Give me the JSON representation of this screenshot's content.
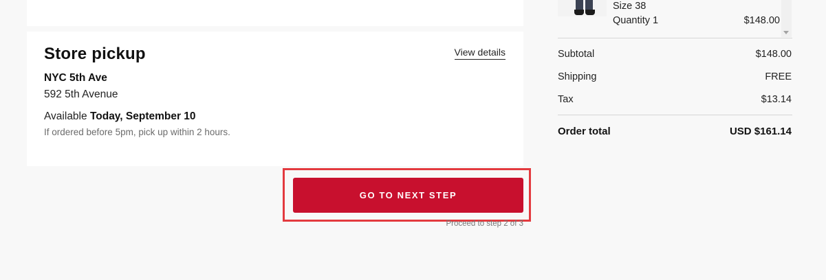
{
  "pickup": {
    "title": "Store pickup",
    "view_details": "View details",
    "store_name": "NYC 5th Ave",
    "store_address": "592 5th Avenue",
    "availability_prefix": "Available",
    "availability_date": "Today, September 10",
    "note": "If ordered before 5pm, pick up within 2 hours."
  },
  "cta": {
    "next_button": "GO TO NEXT STEP",
    "step_hint": "Proceed to step 2 of 3",
    "button_color": "#c8102e",
    "highlight_color": "#e33a3f"
  },
  "product": {
    "size": "Size 38",
    "quantity": "Quantity 1",
    "price": "$148.00"
  },
  "summary": {
    "subtotal_label": "Subtotal",
    "subtotal_value": "$148.00",
    "shipping_label": "Shipping",
    "shipping_value": "FREE",
    "tax_label": "Tax",
    "tax_value": "$13.14",
    "total_label": "Order total",
    "total_value": "USD $161.14"
  }
}
